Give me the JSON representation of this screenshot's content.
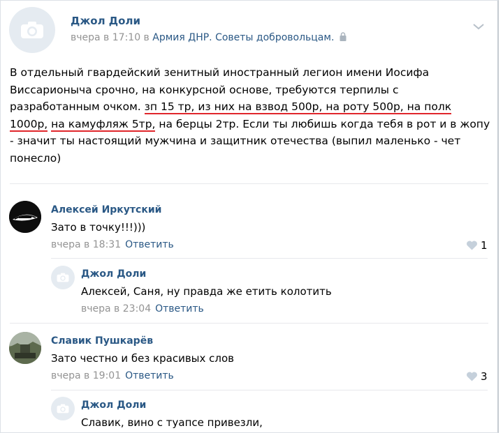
{
  "post": {
    "author": "Джол Доли",
    "time": "вчера в 17:10 в",
    "group": "Армия ДНР. Советы добровольцам.",
    "text_1": "В отдельный гвардейский зенитный иностранный легион имени Иосифа Виссарионыча срочно, на конкурсной основе, требуются терпилы с разработанным очком. ",
    "text_ul_1": "зп 15 тр, из них на взвод 500р, на роту 500р, на полк 1000р,",
    "text_ul_2": "на камуфляж 5тр,",
    "text_2": " на берцы 2тр. Если ты любишь когда тебя в рот и в жопу - значит ты настоящий мужчина и защитник отечества (выпил маленько - чет понесло)",
    "chevron_icon": "chevron-down-icon",
    "camera_icon": "camera-icon",
    "lock_icon": "lock-icon"
  },
  "comments": [
    {
      "author": "Алексей Иркутский",
      "text": "Зато в точку!!!)))",
      "time": "вчера в 18:31",
      "reply": "Ответить",
      "likes": "1"
    },
    {
      "author": "Джол Доли",
      "text": "Алексей, Саня, ну правда же етить колотить",
      "time": "вчера в 23:04",
      "reply": "Ответить"
    },
    {
      "author": "Славик Пушкарёв",
      "text": "Зато честно и без красивых слов",
      "time": "вчера в 19:01",
      "reply": "Ответить",
      "likes": "3"
    },
    {
      "author": "Джол Доли",
      "text": "Славик, вино с туапсе привезли,"
    }
  ],
  "colors": {
    "link": "#2a5885",
    "meta": "#939393",
    "underline": "#e0262b",
    "avatar_bg": "#e5ebf1"
  }
}
